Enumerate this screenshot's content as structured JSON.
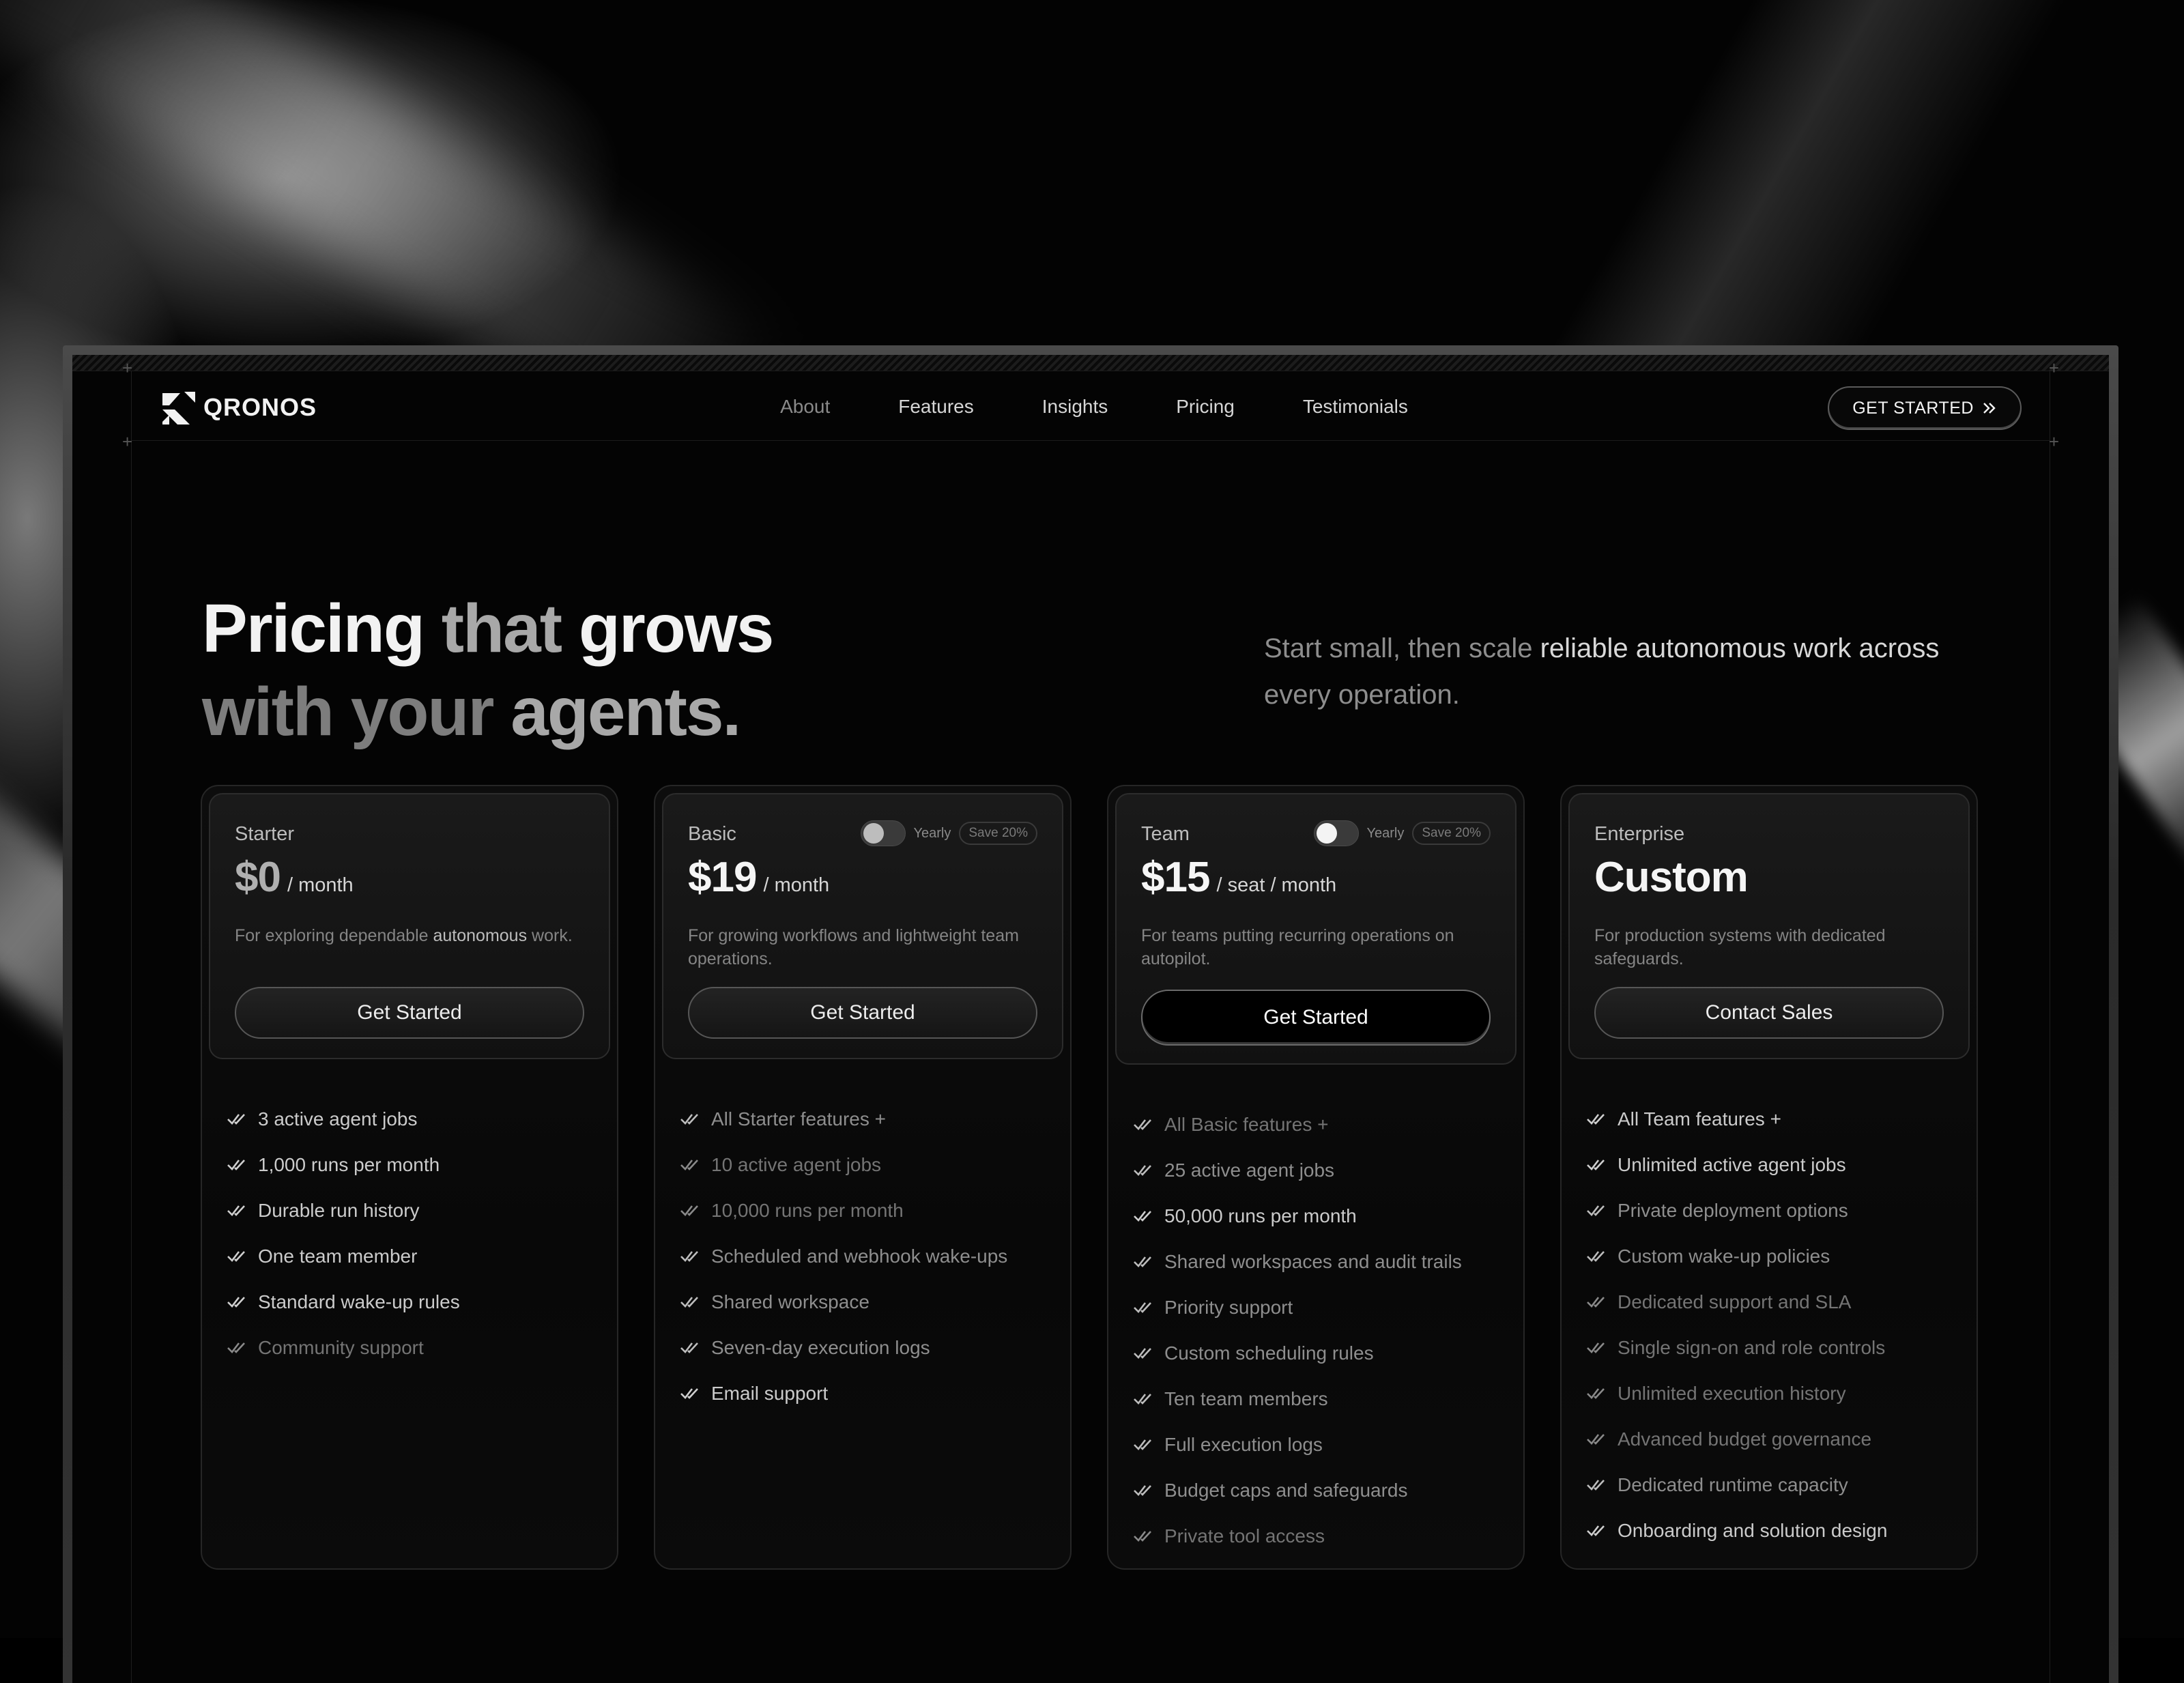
{
  "brand": {
    "name": "QRONOS"
  },
  "nav": {
    "links": [
      "About",
      "Features",
      "Insights",
      "Pricing",
      "Testimonials"
    ],
    "cta": "GET STARTED"
  },
  "hero": {
    "title_part1": "Pricing",
    "title_part2": " that ",
    "title_part3": "grows",
    "title_part4": "with your ",
    "title_part5": "agents.",
    "subtitle_a": "Start small, then scale ",
    "subtitle_b": "reliable autonomous work across",
    "subtitle_c": " every operation."
  },
  "plans": [
    {
      "tier": "Starter",
      "price": "$0",
      "period": "/ month",
      "desc_a": "For exploring dependable ",
      "desc_b": "autonomous",
      "desc_c": " work.",
      "button": "Get Started",
      "features": [
        "3 active agent jobs",
        "1,000 runs per month",
        "Durable run history",
        "One team member",
        "Standard wake-up rules",
        "Community support"
      ]
    },
    {
      "tier": "Basic",
      "price": "$19",
      "period": "/ month",
      "yearly": "Yearly",
      "save": "Save 20%",
      "desc": "For growing workflows and lightweight team operations.",
      "button": "Get Started",
      "features": [
        "All Starter features +",
        "10 active agent jobs",
        "10,000 runs per month",
        "Scheduled and webhook wake-ups",
        "Shared workspace",
        "Seven-day execution logs",
        "Email support"
      ]
    },
    {
      "tier": "Team",
      "price": "$15",
      "period": "/ seat / month",
      "yearly": "Yearly",
      "save": "Save 20%",
      "desc": "For teams putting recurring operations on autopilot.",
      "button": "Get Started",
      "features": [
        "All Basic features +",
        "25 active agent jobs",
        "50,000 runs per month",
        "Shared workspaces and audit trails",
        "Priority support",
        "Custom scheduling rules",
        "Ten team members",
        "Full execution logs",
        "Budget caps and safeguards",
        "Private tool access"
      ]
    },
    {
      "tier": "Enterprise",
      "price": "Custom",
      "desc": "For production systems with dedicated safeguards.",
      "button": "Contact Sales",
      "features": [
        "All Team features +",
        "Unlimited active agent jobs",
        "Private deployment options",
        "Custom wake-up policies",
        "Dedicated support and SLA",
        "Single sign-on and role controls",
        "Unlimited execution history",
        "Advanced budget governance",
        "Dedicated runtime capacity",
        "Onboarding and solution design"
      ]
    }
  ]
}
